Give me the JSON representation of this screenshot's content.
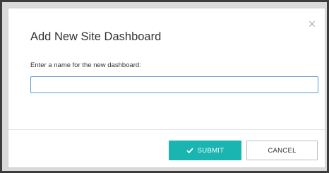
{
  "dialog": {
    "title": "Add New Site Dashboard",
    "close_icon": "close-icon",
    "field_label": "Enter a name for the new dashboard:",
    "field_value": "",
    "field_placeholder": ""
  },
  "buttons": {
    "submit_label": "SUBMIT",
    "submit_icon": "checkmark-icon",
    "cancel_label": "CANCEL"
  },
  "colors": {
    "accent": "#1ab5b0",
    "input_border": "#5b9bd5"
  }
}
